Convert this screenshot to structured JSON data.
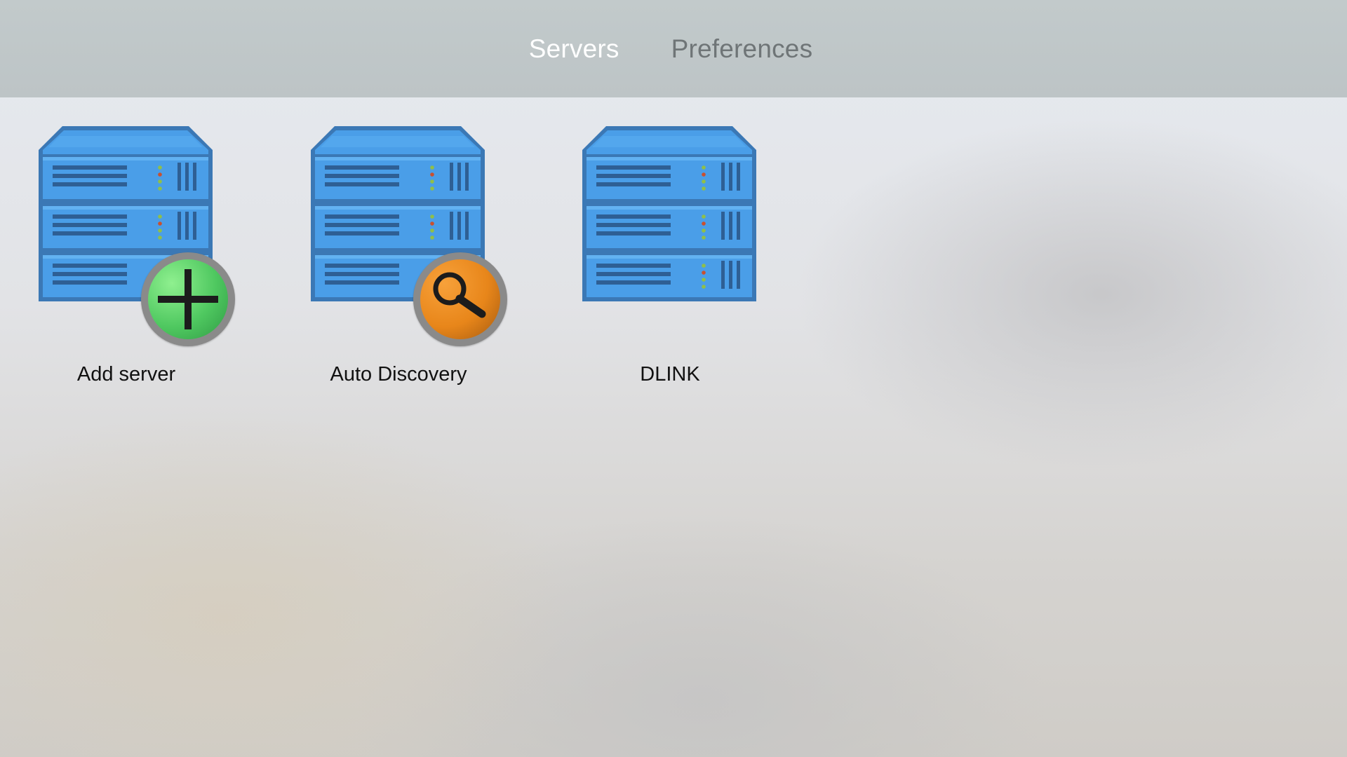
{
  "nav": {
    "tabs": [
      {
        "label": "Servers",
        "active": true
      },
      {
        "label": "Preferences",
        "active": false
      }
    ]
  },
  "servers": {
    "items": [
      {
        "label": "Add server",
        "icon": "server-rack-icon",
        "badge": "plus-icon",
        "badge_color": "#4fc860"
      },
      {
        "label": "Auto Discovery",
        "icon": "server-rack-icon",
        "badge": "magnifier-icon",
        "badge_color": "#e8861a"
      },
      {
        "label": "DLINK",
        "icon": "server-rack-icon",
        "badge": null
      }
    ]
  },
  "colors": {
    "server_blue": "#4a9ee8",
    "server_border": "#3b78b5",
    "tab_active": "#ffffff",
    "tab_inactive": "#6f7577",
    "topbar": "#c0c7c9"
  }
}
